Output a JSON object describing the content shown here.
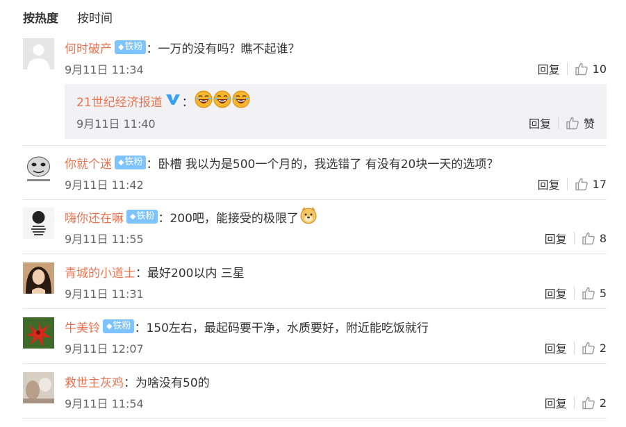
{
  "tabs": [
    {
      "label": "按热度",
      "active": true
    },
    {
      "label": "按时间",
      "active": false
    }
  ],
  "reply_label": "回复",
  "badge_label": "铁粉",
  "colon": "：",
  "comments": [
    {
      "username": "何时破产",
      "has_badge": true,
      "text": "一万的没有吗？瞧不起谁？",
      "time": "9月11日 11:34",
      "likes": "10",
      "avatar": "default-avatar"
    },
    {
      "username": "你就个迷",
      "has_badge": true,
      "text": "卧槽 我以为是500一个月的，我选错了 有没有20块一天的选项？",
      "time": "9月11日 11:42",
      "likes": "17",
      "avatar": "meme-face-avatar"
    },
    {
      "username": "嗨你还在嘛",
      "has_badge": true,
      "text": "200吧，能接受的极限了",
      "time": "9月11日 11:55",
      "likes": "8",
      "avatar": "meme-text-avatar",
      "emoji": "doge-emoji"
    },
    {
      "username": "青城的小道士",
      "has_badge": false,
      "text": "最好200以内 三星",
      "time": "9月11日 11:31",
      "likes": "5",
      "avatar": "woman-photo-avatar"
    },
    {
      "username": "牛美铃",
      "has_badge": true,
      "text": "150左右，最起码要干净，水质要好，附近能吃饭就行",
      "time": "9月11日 12:07",
      "likes": "2",
      "avatar": "red-flower-avatar"
    },
    {
      "username": "救世主灰鸡",
      "has_badge": false,
      "text": "为啥没有50的",
      "time": "9月11日 11:54",
      "likes": "2",
      "avatar": "blurred-photo-avatar"
    }
  ],
  "sub_reply": {
    "username": "21世纪经济报道",
    "verified": true,
    "emojis": [
      "laughing-emoji",
      "laughing-emoji",
      "laughing-emoji"
    ],
    "time": "9月11日 11:40",
    "like_label": "赞"
  },
  "colors": {
    "username": "#eb7350",
    "badge": "#7cc3ff",
    "verified": "#3aa1f2",
    "subbox_bg": "#f2f2f5"
  }
}
